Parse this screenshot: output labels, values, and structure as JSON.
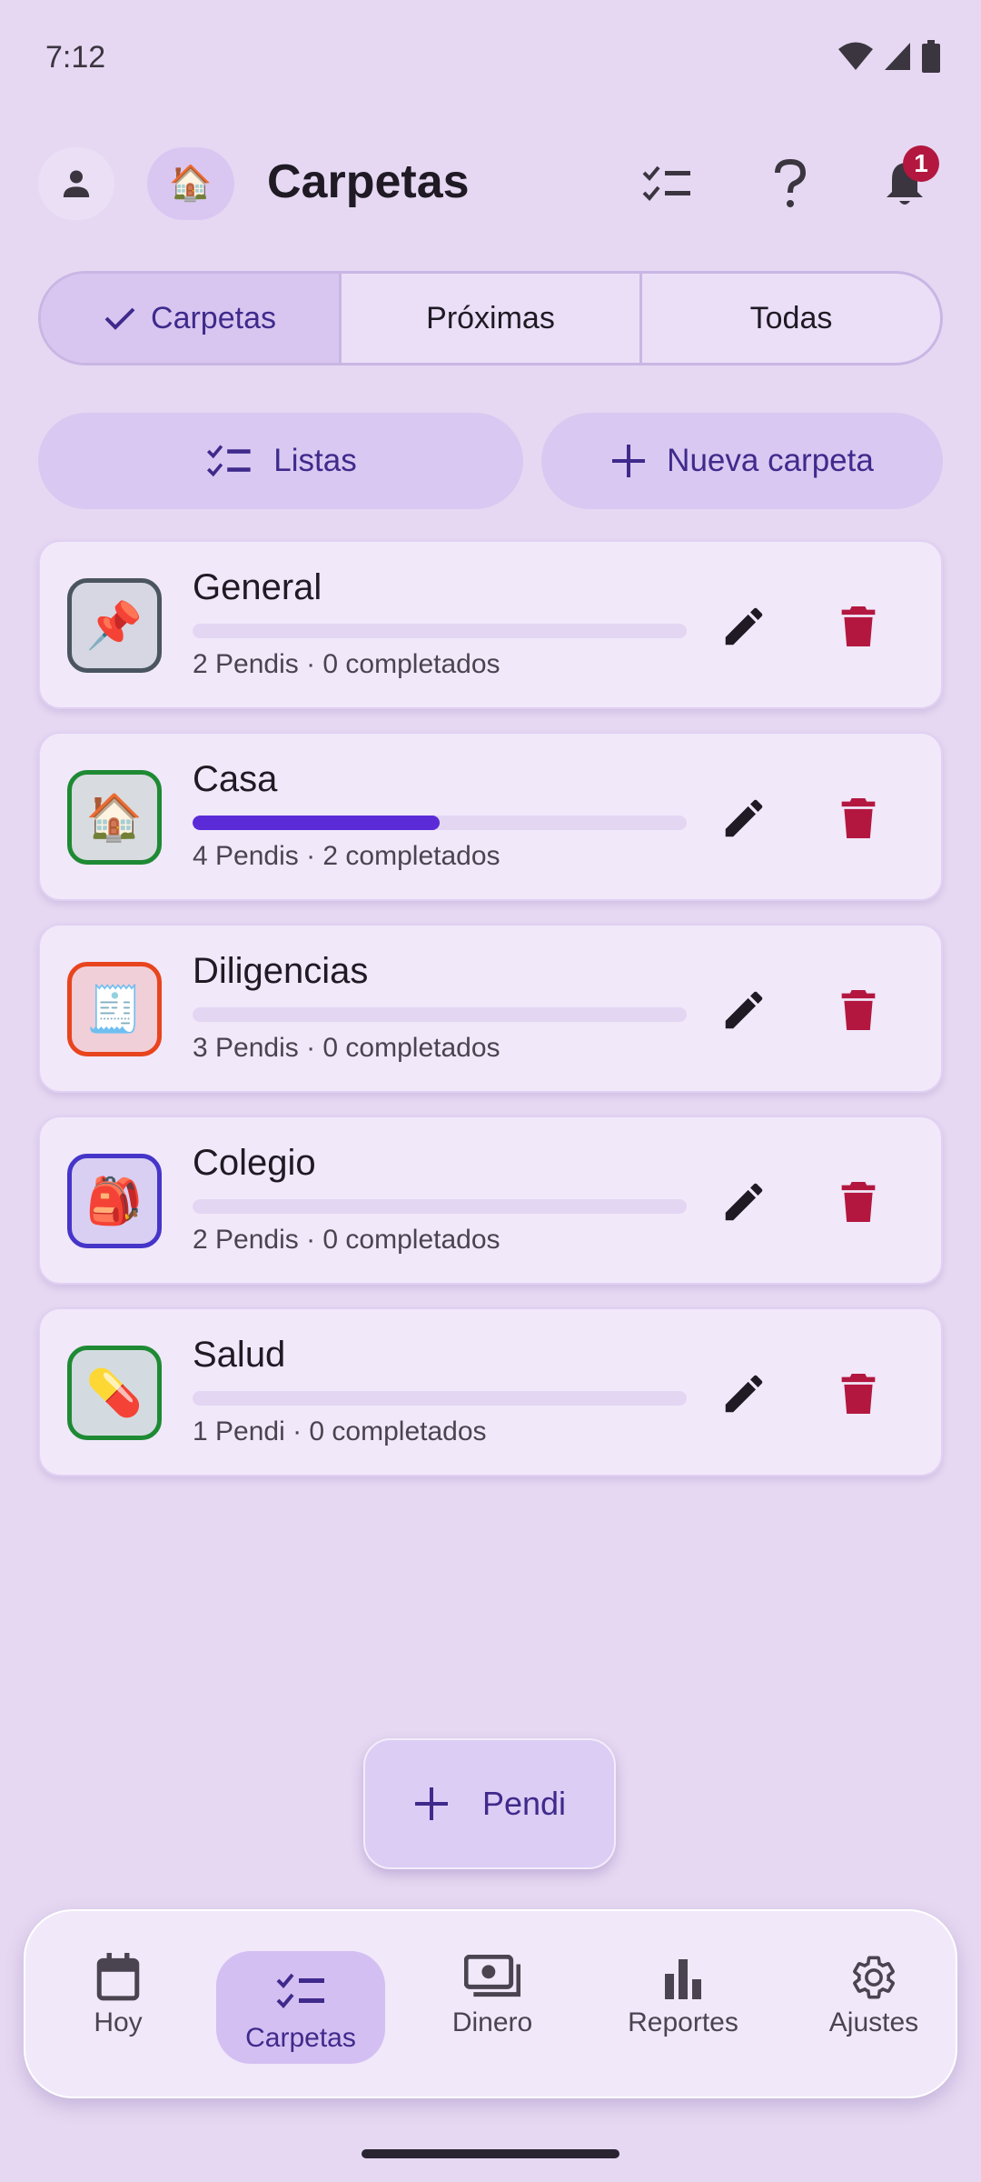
{
  "status_bar": {
    "time": "7:12"
  },
  "header": {
    "title": "Carpetas",
    "folder_emoji": "🏠",
    "notification_count": "1"
  },
  "tabs": [
    {
      "label": "Carpetas",
      "selected": true
    },
    {
      "label": "Próximas",
      "selected": false
    },
    {
      "label": "Todas",
      "selected": false
    }
  ],
  "actions": {
    "lists_label": "Listas",
    "new_folder_label": "Nueva carpeta"
  },
  "folders": [
    {
      "name": "General",
      "emoji": "📌",
      "border_color": "#4A5560",
      "bg_color": "#D7D6E3",
      "subtitle": "2 Pendis · 0 completados",
      "progress": 0.0
    },
    {
      "name": "Casa",
      "emoji": "🏠",
      "border_color": "#1E8A34",
      "bg_color": "#D8DBE0",
      "subtitle": "4 Pendis · 2 completados",
      "progress": 0.5
    },
    {
      "name": "Diligencias",
      "emoji": "🧾",
      "border_color": "#E8441E",
      "bg_color": "#F0CFD9",
      "subtitle": "3 Pendis · 0 completados",
      "progress": 0.0
    },
    {
      "name": "Colegio",
      "emoji": "🎒",
      "border_color": "#4535C9",
      "bg_color": "#D9CFF3",
      "subtitle": "2 Pendis · 0 completados",
      "progress": 0.0
    },
    {
      "name": "Salud",
      "emoji": "💊",
      "border_color": "#1E8A34",
      "bg_color": "#D3DBE0",
      "subtitle": "1 Pendi · 0 completados",
      "progress": 0.0
    }
  ],
  "fab": {
    "label": "Pendi"
  },
  "bottom_nav": [
    {
      "label": "Hoy",
      "icon": "calendar-icon",
      "active": false
    },
    {
      "label": "Carpetas",
      "icon": "checklist-icon",
      "active": true
    },
    {
      "label": "Dinero",
      "icon": "money-icon",
      "active": false
    },
    {
      "label": "Reportes",
      "icon": "bar-chart-icon",
      "active": false
    },
    {
      "label": "Ajustes",
      "icon": "gear-icon",
      "active": false
    }
  ],
  "colors": {
    "accent": "#5B2BD8",
    "delete": "#B3173F",
    "background": "#E6D8F2"
  }
}
